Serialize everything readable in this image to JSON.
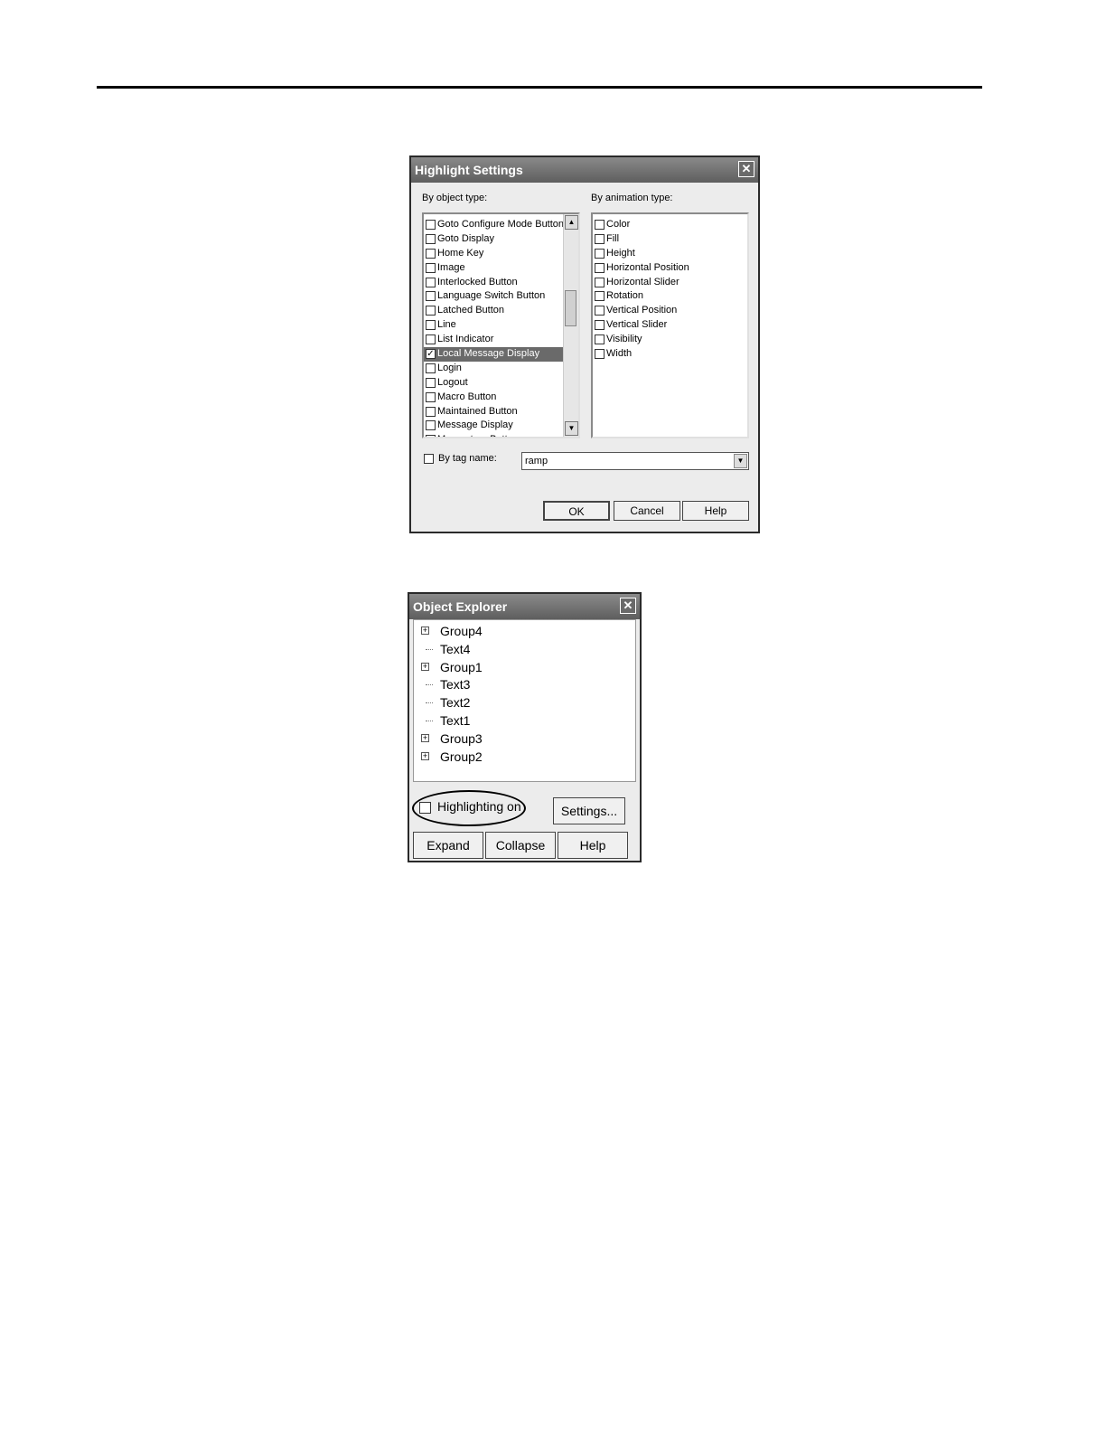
{
  "highlight_settings": {
    "title": "Highlight Settings",
    "object_type_label": "By object type:",
    "animation_type_label": "By animation type:",
    "object_types": [
      {
        "label": "Goto Configure Mode Button",
        "checked": false
      },
      {
        "label": "Goto Display",
        "checked": false
      },
      {
        "label": "Home Key",
        "checked": false
      },
      {
        "label": "Image",
        "checked": false
      },
      {
        "label": "Interlocked Button",
        "checked": false
      },
      {
        "label": "Language Switch Button",
        "checked": false
      },
      {
        "label": "Latched Button",
        "checked": false
      },
      {
        "label": "Line",
        "checked": false
      },
      {
        "label": "List Indicator",
        "checked": false
      },
      {
        "label": "Local Message Display",
        "checked": true,
        "selected": true
      },
      {
        "label": "Login",
        "checked": false
      },
      {
        "label": "Logout",
        "checked": false
      },
      {
        "label": "Macro Button",
        "checked": false
      },
      {
        "label": "Maintained Button",
        "checked": false
      },
      {
        "label": "Message Display",
        "checked": false
      },
      {
        "label": "Momentary Button",
        "checked": false
      }
    ],
    "animation_types": [
      {
        "label": "Color",
        "checked": false
      },
      {
        "label": "Fill",
        "checked": false
      },
      {
        "label": "Height",
        "checked": false
      },
      {
        "label": "Horizontal Position",
        "checked": false
      },
      {
        "label": "Horizontal Slider",
        "checked": false
      },
      {
        "label": "Rotation",
        "checked": false
      },
      {
        "label": "Vertical Position",
        "checked": false
      },
      {
        "label": "Vertical Slider",
        "checked": false
      },
      {
        "label": "Visibility",
        "checked": false
      },
      {
        "label": "Width",
        "checked": false
      }
    ],
    "tag_name_label": "By tag name:",
    "tag_name_checked": false,
    "tag_name_value": "ramp",
    "ok_label": "OK",
    "cancel_label": "Cancel",
    "help_label": "Help"
  },
  "object_explorer": {
    "title": "Object Explorer",
    "nodes": [
      {
        "label": "Group4",
        "expandable": true
      },
      {
        "label": "Text4",
        "expandable": false
      },
      {
        "label": "Group1",
        "expandable": true
      },
      {
        "label": "Text3",
        "expandable": false
      },
      {
        "label": "Text2",
        "expandable": false
      },
      {
        "label": "Text1",
        "expandable": false
      },
      {
        "label": "Group3",
        "expandable": true
      },
      {
        "label": "Group2",
        "expandable": true
      }
    ],
    "highlighting_label": "Highlighting on",
    "highlighting_checked": false,
    "settings_label": "Settings...",
    "expand_label": "Expand",
    "collapse_label": "Collapse",
    "help_label": "Help"
  }
}
